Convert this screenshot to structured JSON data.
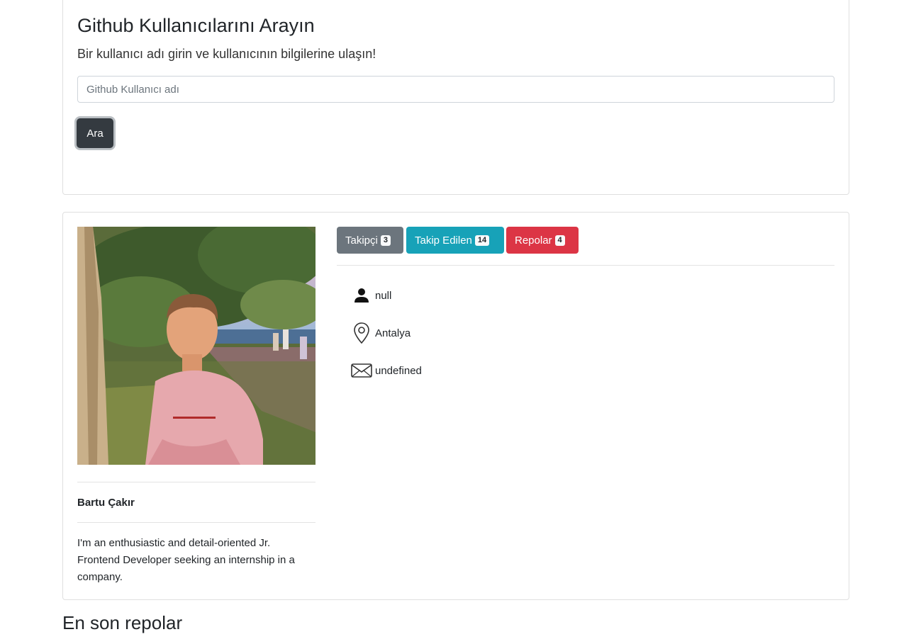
{
  "search": {
    "title": "Github Kullanıcılarını Arayın",
    "subtitle": "Bir kullanıcı adı girin ve kullanıcının bilgilerine ulaşın!",
    "placeholder": "Github Kullanıcı adı",
    "value": "",
    "button_label": "Ara"
  },
  "profile": {
    "name": "Bartu Çakır",
    "bio": "I'm an enthusiastic and detail-oriented Jr. Frontend Developer seeking an internship in a company.",
    "stats": {
      "followers_label": "Takipçi",
      "followers_count": "3",
      "following_label": "Takip Edilen",
      "following_count": "14",
      "repos_label": "Repolar",
      "repos_count": "4"
    },
    "info": {
      "company": "null",
      "location": "Antalya",
      "email": "undefined"
    }
  },
  "recent": {
    "heading": "En son repolar"
  },
  "icons": {
    "company": "person-icon",
    "location": "location-pin-icon",
    "email": "envelope-icon"
  },
  "colors": {
    "search_button": "#343a40",
    "followers": "#6c757d",
    "following": "#17a2b8",
    "repos": "#dc3545"
  }
}
